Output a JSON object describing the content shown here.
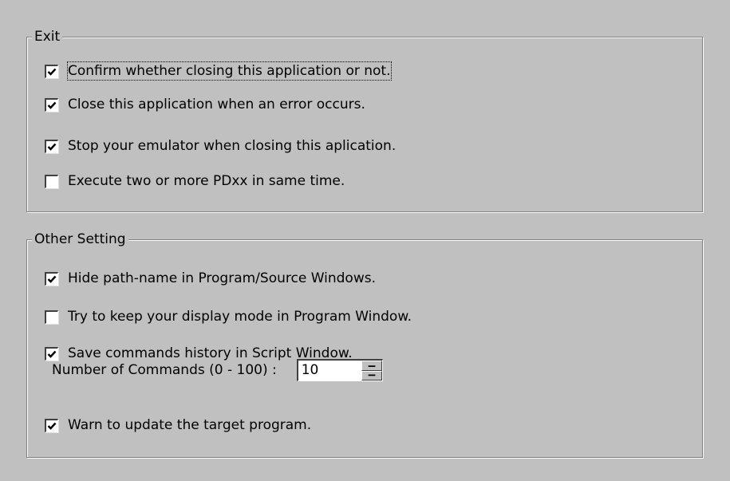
{
  "exit_group": {
    "title": "Exit",
    "options": [
      {
        "label": "Confirm whether closing this application or not.",
        "checked": true
      },
      {
        "label": "Close this application when an error occurs.",
        "checked": true
      },
      {
        "label": "Stop your emulator when closing this aplication.",
        "checked": true
      },
      {
        "label": "Execute two or more PDxx in same time.",
        "checked": false
      }
    ]
  },
  "other_group": {
    "title": "Other Setting",
    "options": [
      {
        "label": "Hide path-name in Program/Source Windows.",
        "checked": true
      },
      {
        "label": "Try to keep your display mode in Program Window.",
        "checked": false
      },
      {
        "label": "Save commands history in Script Window.",
        "checked": true
      },
      {
        "label": "Warn to update the target program.",
        "checked": true
      }
    ],
    "commands": {
      "label": "Number of Commands (0 - 100) :",
      "value": "10",
      "min": 0,
      "max": 100
    }
  }
}
